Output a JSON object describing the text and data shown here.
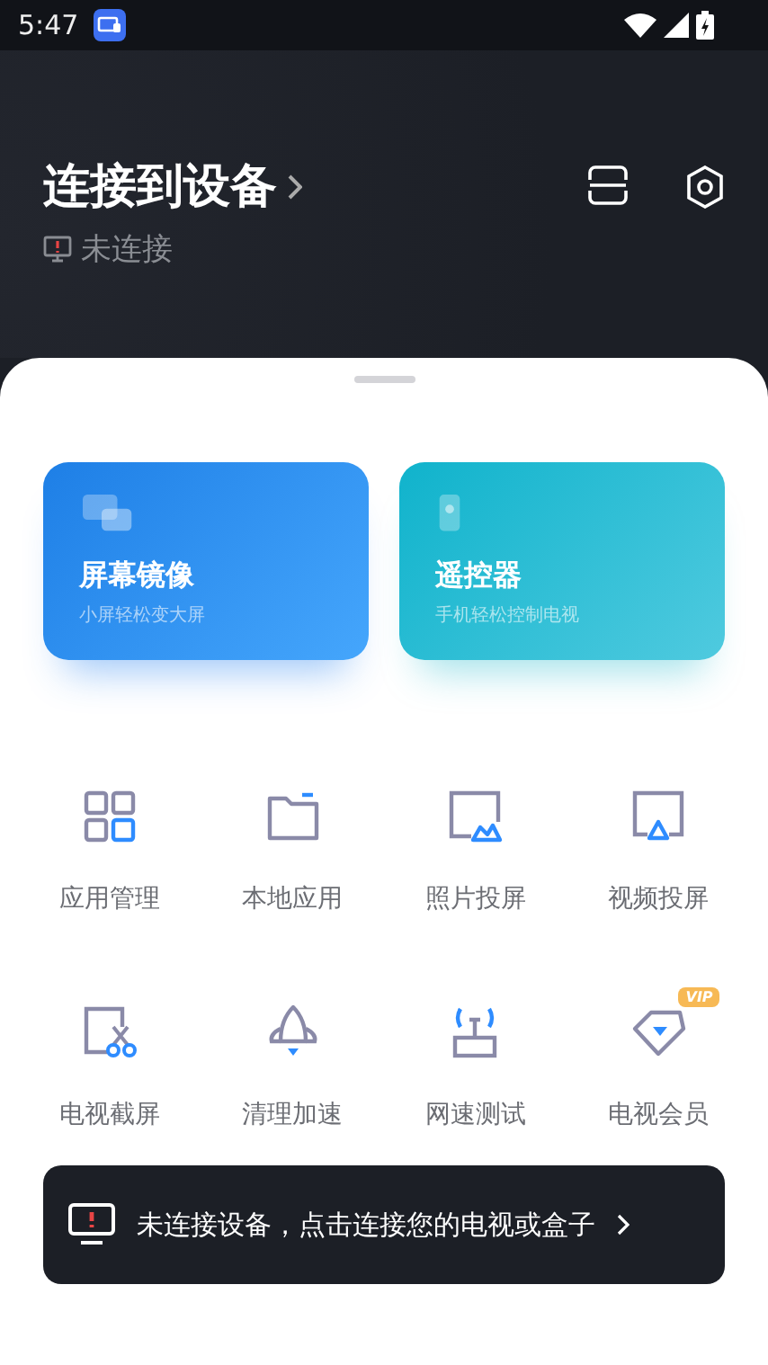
{
  "status_bar": {
    "time": "5:47"
  },
  "header": {
    "title": "连接到设备",
    "status": "未连接"
  },
  "cards": [
    {
      "title": "屏幕镜像",
      "subtitle": "小屏轻松变大屏",
      "kind": "mirror"
    },
    {
      "title": "遥控器",
      "subtitle": "手机轻松控制电视",
      "kind": "remote"
    }
  ],
  "tools": [
    {
      "label": "应用管理"
    },
    {
      "label": "本地应用"
    },
    {
      "label": "照片投屏"
    },
    {
      "label": "视频投屏"
    },
    {
      "label": "电视截屏"
    },
    {
      "label": "清理加速"
    },
    {
      "label": "网速测试"
    },
    {
      "label": "电视会员",
      "badge": "VIP"
    }
  ],
  "banner": {
    "text": "未连接设备，点击连接您的电视或盒子"
  }
}
